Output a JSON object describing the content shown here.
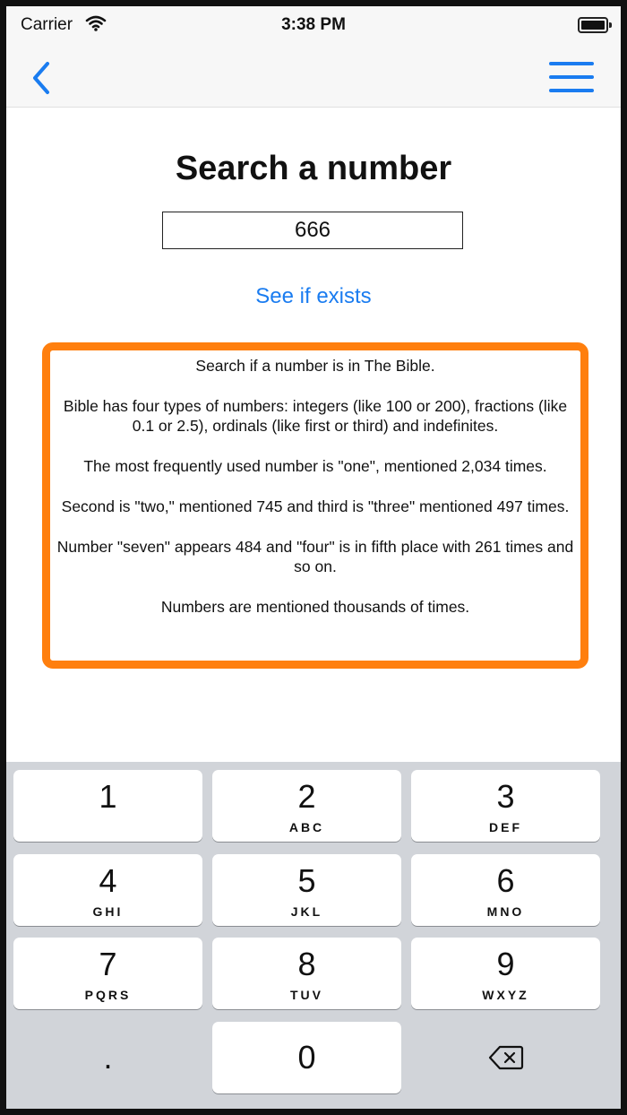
{
  "status_bar": {
    "carrier": "Carrier",
    "time": "3:38 PM"
  },
  "nav": {
    "back_icon": "chevron-left-icon",
    "menu_icon": "hamburger-menu-icon",
    "accent": "#1a7cf0"
  },
  "main": {
    "title": "Search a number",
    "search_value": "666",
    "exists_link": "See if exists",
    "info_border_color": "#ff7f0e",
    "info_paragraphs": [
      "Search if a number is in The Bible.",
      "Bible has four types of numbers: integers (like 100 or 200), fractions (like 0.1 or 2.5), ordinals (like first or third) and indefinites.",
      "The most frequently used number is \"one\", mentioned 2,034 times.",
      "Second is \"two,\" mentioned 745 and third is \"three\" mentioned 497 times.",
      "Number \"seven\" appears 484 and \"four\" is in fifth place with 261 times and so on.",
      "Numbers are mentioned thousands of times."
    ]
  },
  "keypad": {
    "keys": [
      {
        "digit": "1",
        "letters": ""
      },
      {
        "digit": "2",
        "letters": "ABC"
      },
      {
        "digit": "3",
        "letters": "DEF"
      },
      {
        "digit": "4",
        "letters": "GHI"
      },
      {
        "digit": "5",
        "letters": "JKL"
      },
      {
        "digit": "6",
        "letters": "MNO"
      },
      {
        "digit": "7",
        "letters": "PQRS"
      },
      {
        "digit": "8",
        "letters": "TUV"
      },
      {
        "digit": "9",
        "letters": "WXYZ"
      }
    ],
    "decimal": ".",
    "zero": "0",
    "delete_icon": "backspace-icon"
  }
}
